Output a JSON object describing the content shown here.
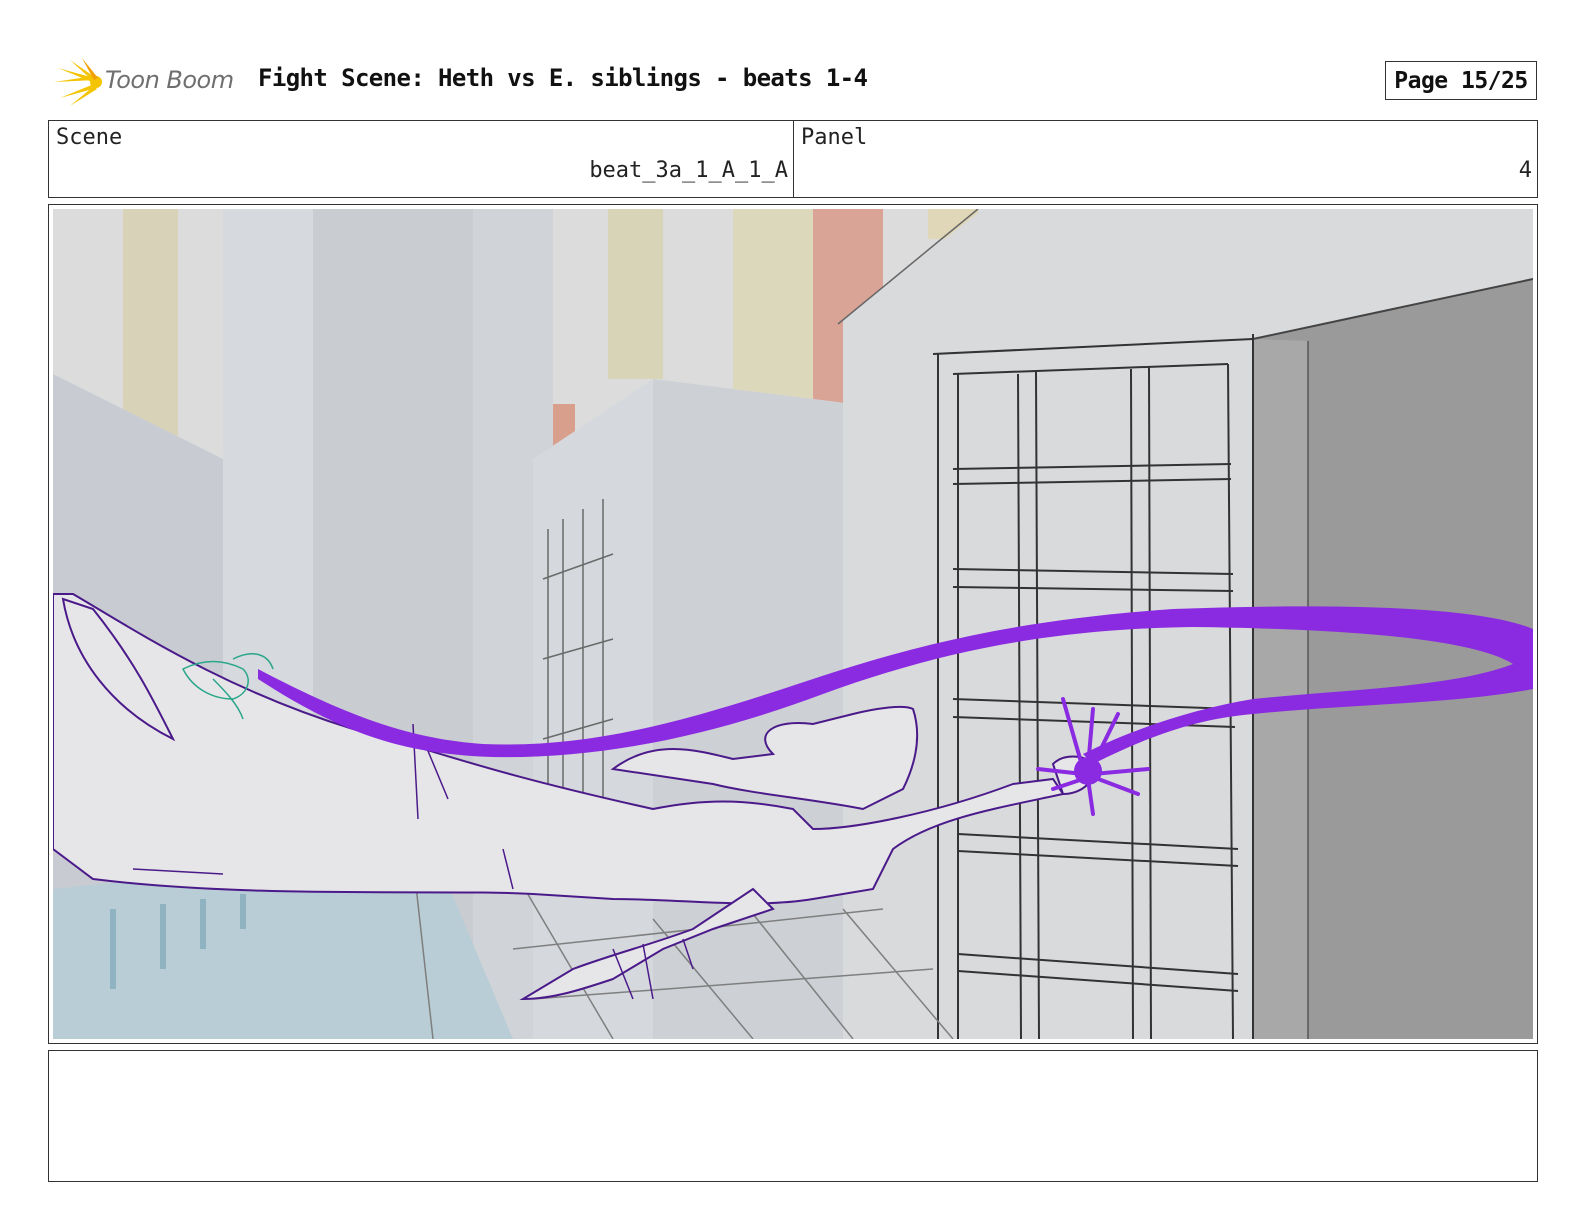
{
  "header": {
    "logo_text": "Toon Boom",
    "title": "Fight Scene: Heth vs E. siblings - beats 1-4",
    "page": "Page 15/25"
  },
  "info": {
    "scene_label": "Scene",
    "scene_value": "beat_3a_1_A_1_A",
    "panel_label": "Panel",
    "panel_value": "4"
  },
  "colors": {
    "energy_beam": "#8a2be2",
    "character_line": "#4b1a8a",
    "building_gray": "#9b9b9b"
  }
}
